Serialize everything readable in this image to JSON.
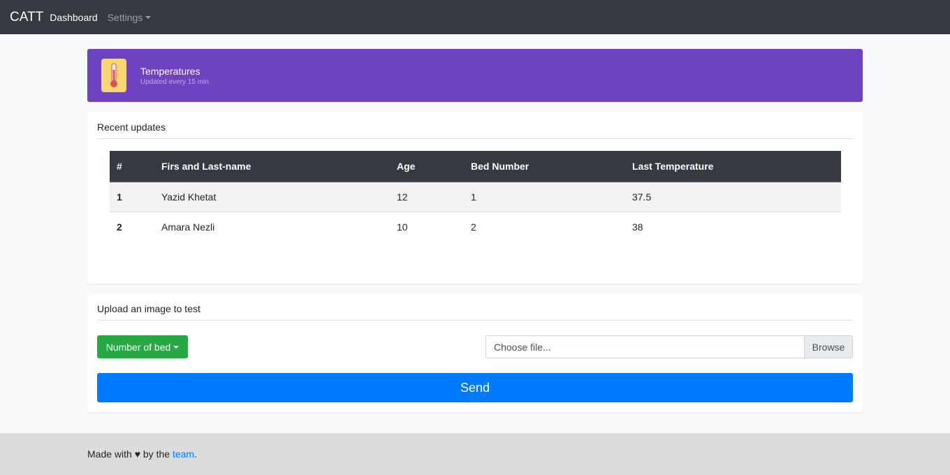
{
  "navbar": {
    "brand": "CATT",
    "dashboard_label": "Dashboard",
    "settings_label": "Settings"
  },
  "banner": {
    "title": "Temperatures",
    "subtitle": "Updated every 15 min",
    "icon": "thermometer-icon",
    "color": "#6f42c1"
  },
  "updates": {
    "title": "Recent updates",
    "columns": [
      "#",
      "Firs and Last-name",
      "Age",
      "Bed Number",
      "Last Temperature"
    ],
    "rows": [
      [
        "1",
        "Yazid Khetat",
        "12",
        "1",
        "37.5"
      ],
      [
        "2",
        "Amara Nezli",
        "10",
        "2",
        "38"
      ]
    ]
  },
  "upload": {
    "title": "Upload an image to test",
    "bed_dropdown_label": "Number of bed",
    "file_placeholder": "Choose file...",
    "browse_label": "Browse",
    "send_label": "Send"
  },
  "footer": {
    "prefix": "Made with ♥ by the ",
    "link": "team",
    "suffix": "."
  },
  "colors": {
    "navbar": "#343a40",
    "table_header": "#343a40",
    "success": "#28a745",
    "primary": "#007bff"
  }
}
